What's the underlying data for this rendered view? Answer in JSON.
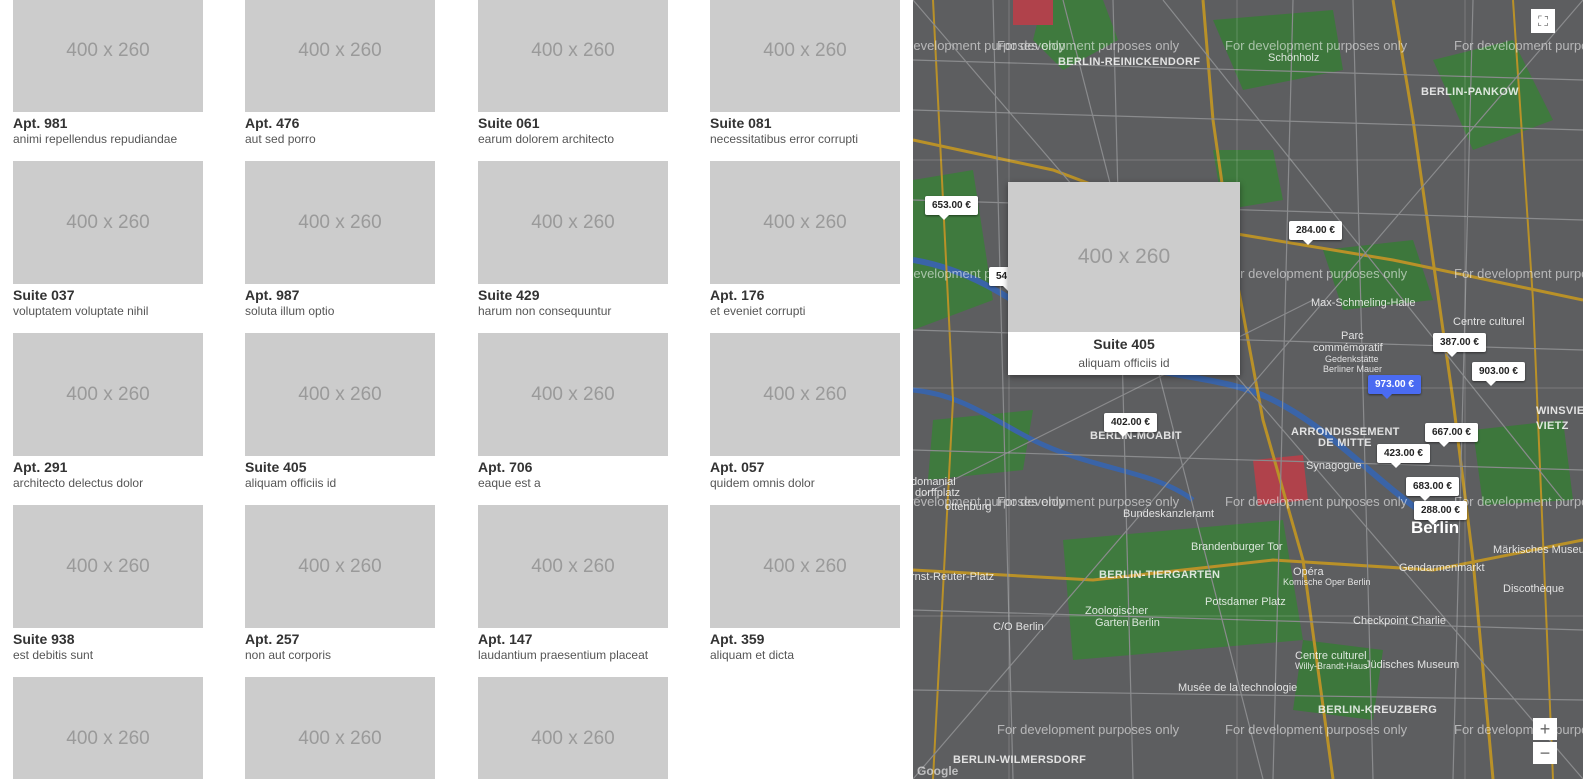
{
  "listings": [
    {
      "img": "400 x 260",
      "title": "Apt. 981",
      "desc": "animi repellendus repudiandae"
    },
    {
      "img": "400 x 260",
      "title": "Apt. 476",
      "desc": "aut sed porro"
    },
    {
      "img": "400 x 260",
      "title": "Suite 061",
      "desc": "earum dolorem architecto"
    },
    {
      "img": "400 x 260",
      "title": "Suite 081",
      "desc": "necessitatibus error corrupti"
    },
    {
      "img": "400 x 260",
      "title": "Suite 037",
      "desc": "voluptatem voluptate nihil"
    },
    {
      "img": "400 x 260",
      "title": "Apt. 987",
      "desc": "soluta illum optio"
    },
    {
      "img": "400 x 260",
      "title": "Suite 429",
      "desc": "harum non consequuntur"
    },
    {
      "img": "400 x 260",
      "title": "Apt. 176",
      "desc": "et eveniet corrupti"
    },
    {
      "img": "400 x 260",
      "title": "Apt. 291",
      "desc": "architecto delectus dolor"
    },
    {
      "img": "400 x 260",
      "title": "Suite 405",
      "desc": "aliquam officiis id"
    },
    {
      "img": "400 x 260",
      "title": "Apt. 706",
      "desc": "eaque est a"
    },
    {
      "img": "400 x 260",
      "title": "Apt. 057",
      "desc": "quidem omnis dolor"
    },
    {
      "img": "400 x 260",
      "title": "Suite 938",
      "desc": "est debitis sunt"
    },
    {
      "img": "400 x 260",
      "title": "Apt. 257",
      "desc": "non aut corporis"
    },
    {
      "img": "400 x 260",
      "title": "Apt. 147",
      "desc": "laudantium praesentium placeat"
    },
    {
      "img": "400 x 260",
      "title": "Apt. 359",
      "desc": "aliquam et dicta"
    },
    {
      "img": "400 x 260",
      "title": "",
      "desc": ""
    },
    {
      "img": "400 x 260",
      "title": "",
      "desc": ""
    },
    {
      "img": "400 x 260",
      "title": "",
      "desc": ""
    }
  ],
  "map": {
    "watermark": "For development purposes only",
    "places": {
      "reinickendorf": "BERLIN-REINICKENDORF",
      "schonholz": "Schönholz",
      "pankow": "BERLIN-PANKOW",
      "schmeling": "Max-Schmeling-Halle",
      "centre_culturel": "Centre culturel",
      "parc": "Parc",
      "commemoratif": "commémoratif",
      "gedenkstatte": "Gedenkstätte",
      "bernauer": "Berliner Mauer",
      "moabit": "BERLIN-MOABIT",
      "arrondissement": "ARRONDISSEMENT",
      "de_mitte": "DE MITTE",
      "synagogue": "Synagogue",
      "winsvier": "WINSVIER",
      "vietz": "VIETZ",
      "kanzleramt": "Bundeskanzleramt",
      "berlin": "Berlin",
      "tor": "Brandenburger Tor",
      "tiergarten": "BERLIN-TIERGARTEN",
      "opera": "Opéra",
      "komische": "Komische Oper Berlin",
      "ernst": "rnst-Reuter-Platz",
      "potsdamer": "Potsdamer Platz",
      "gendarmenmarkt": "Gendarmenmarkt",
      "zoo": "Zoologischer",
      "zoo2": "Garten Berlin",
      "checkpoint": "Checkpoint Charlie",
      "co": "C/O Berlin",
      "willy": "Centre culturel",
      "willy2": "Willy-Brandt-Haus",
      "judisches": "Jüdisches Museum",
      "technologie": "Musée de la technologie",
      "kreuzberg": "BERLIN-KREUZBERG",
      "wilmersdorf": "BERLIN-WILMERSDORF",
      "charlottenburg": "ottenburg",
      "domanial": "domanial",
      "charl2": "dorffplatz",
      "markisches": "Märkisches Museum",
      "discotheque": "Discothèque"
    },
    "prices": [
      {
        "label": "653.00 €",
        "active": false
      },
      {
        "label": "54",
        "active": false
      },
      {
        "label": "284.00 €",
        "active": false
      },
      {
        "label": "387.00 €",
        "active": false
      },
      {
        "label": "903.00 €",
        "active": false
      },
      {
        "label": "973.00 €",
        "active": true
      },
      {
        "label": "402.00 €",
        "active": false
      },
      {
        "label": "667.00 €",
        "active": false
      },
      {
        "label": "423.00 €",
        "active": false
      },
      {
        "label": "683.00 €",
        "active": false
      },
      {
        "label": "288.00 €",
        "active": false
      }
    ],
    "popup": {
      "img": "400 x 260",
      "title": "Suite 405",
      "desc": "aliquam officiis id"
    },
    "controls": {
      "zoom_in": "+",
      "zoom_out": "−",
      "fullscreen": "⛶"
    },
    "attribution": "Google"
  }
}
